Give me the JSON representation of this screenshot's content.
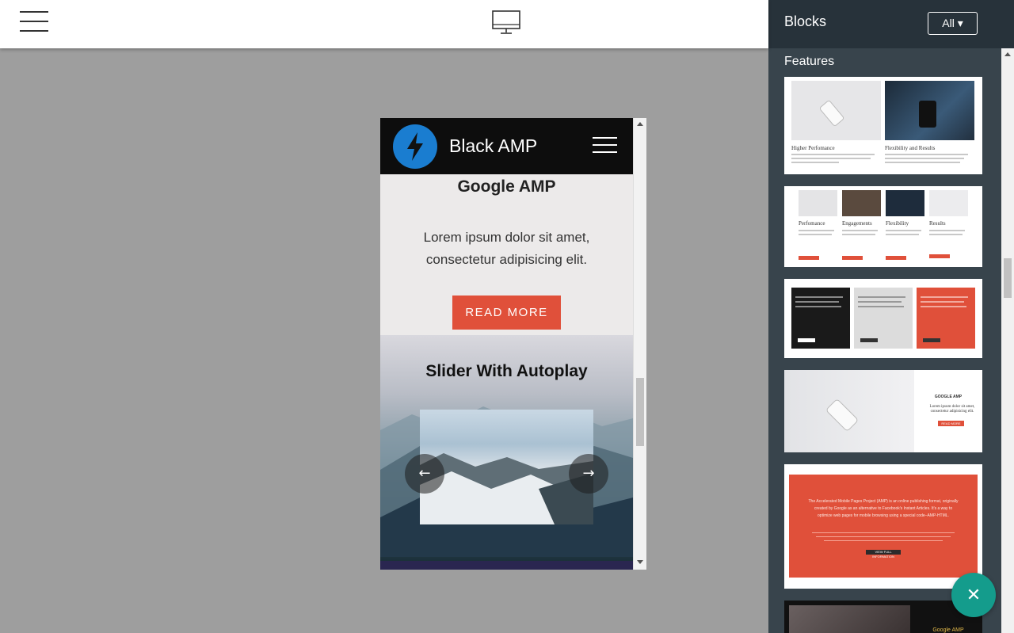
{
  "toolbar": {
    "menu_icon": "hamburger-icon",
    "device_icon": "desktop-monitor-icon"
  },
  "preview": {
    "brand": "Black AMP",
    "logo_icon": "lightning-bolt-icon",
    "menu_icon": "hamburger-icon",
    "section_title": "Google AMP",
    "section_text": "Lorem ipsum dolor sit amet, consectetur adipisicing elit.",
    "button_label": "READ MORE",
    "slider_title": "Slider With Autoplay",
    "prev_arrow": "←",
    "next_arrow": "→",
    "colors": {
      "nav": "#0d0d0d",
      "logo": "#1a7dd0",
      "button": "#e0503a",
      "section_bg": "#eceaea"
    }
  },
  "sidebar": {
    "title": "Blocks",
    "filter_label": "All ▾",
    "section_label": "Features",
    "thumbnails": {
      "t1": {
        "col1": "Higher Perfomance",
        "col2": "Flexibility and Results"
      },
      "t2": {
        "col1": "Perfomance",
        "col2": "Engagements",
        "col3": "Flexibility",
        "col4": "Results"
      },
      "t4": {
        "heading": "GOOGLE AMP",
        "text": "Lorem ipsum dolor sit amet, consectetur adipisicing elit.",
        "button": "READ MORE"
      },
      "t5": {
        "text": "The Accelerated Mobile Pages Project (AMP) is an online publishing format, originally created by Google as an alternative to Facebook's Instant Articles. It's a way to optimize web pages for mobile browsing using a special code–AMP-HTML.",
        "button": "VIEW FULL INFORMATION"
      },
      "t6": {
        "heading": "Google AMP"
      }
    }
  },
  "fab": {
    "icon": "close-icon",
    "glyph": "✕",
    "color": "#149c8c"
  }
}
